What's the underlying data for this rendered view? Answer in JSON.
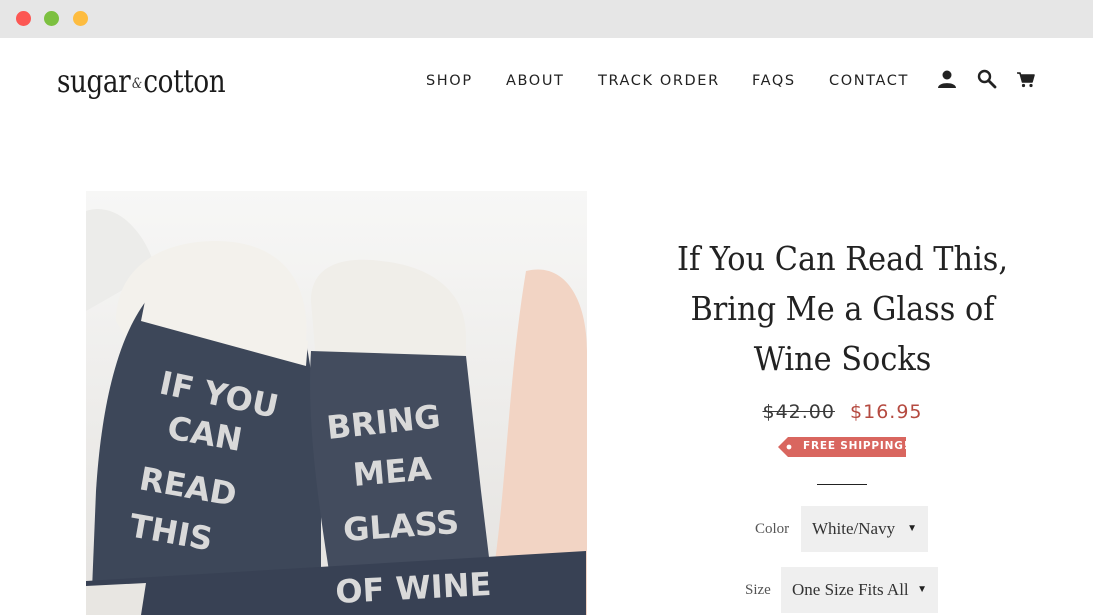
{
  "brand": {
    "logo_left": "sugar",
    "logo_amp": "&",
    "logo_right": "cotton"
  },
  "nav": {
    "items": [
      "SHOP",
      "ABOUT",
      "TRACK ORDER",
      "FAQS",
      "CONTACT"
    ],
    "icons": [
      "account-icon",
      "search-icon",
      "cart-icon"
    ]
  },
  "product": {
    "title": "If You Can Read This, Bring Me a Glass of Wine Socks",
    "compare_price": "$42.00",
    "sale_price": "$16.95",
    "badge": "FREE SHIPPING!",
    "image_text_left": [
      "IF YOU",
      "CAN",
      "READ",
      "THIS"
    ],
    "image_text_right": [
      "BRING",
      "MEA",
      "GLASS",
      "OF WINE"
    ],
    "options": {
      "color": {
        "label": "Color",
        "value": "White/Navy"
      },
      "size": {
        "label": "Size",
        "value": "One Size Fits All"
      }
    }
  },
  "colors": {
    "sale": "#b54a40",
    "badge": "#d9665f",
    "sock": "#3d4759"
  }
}
